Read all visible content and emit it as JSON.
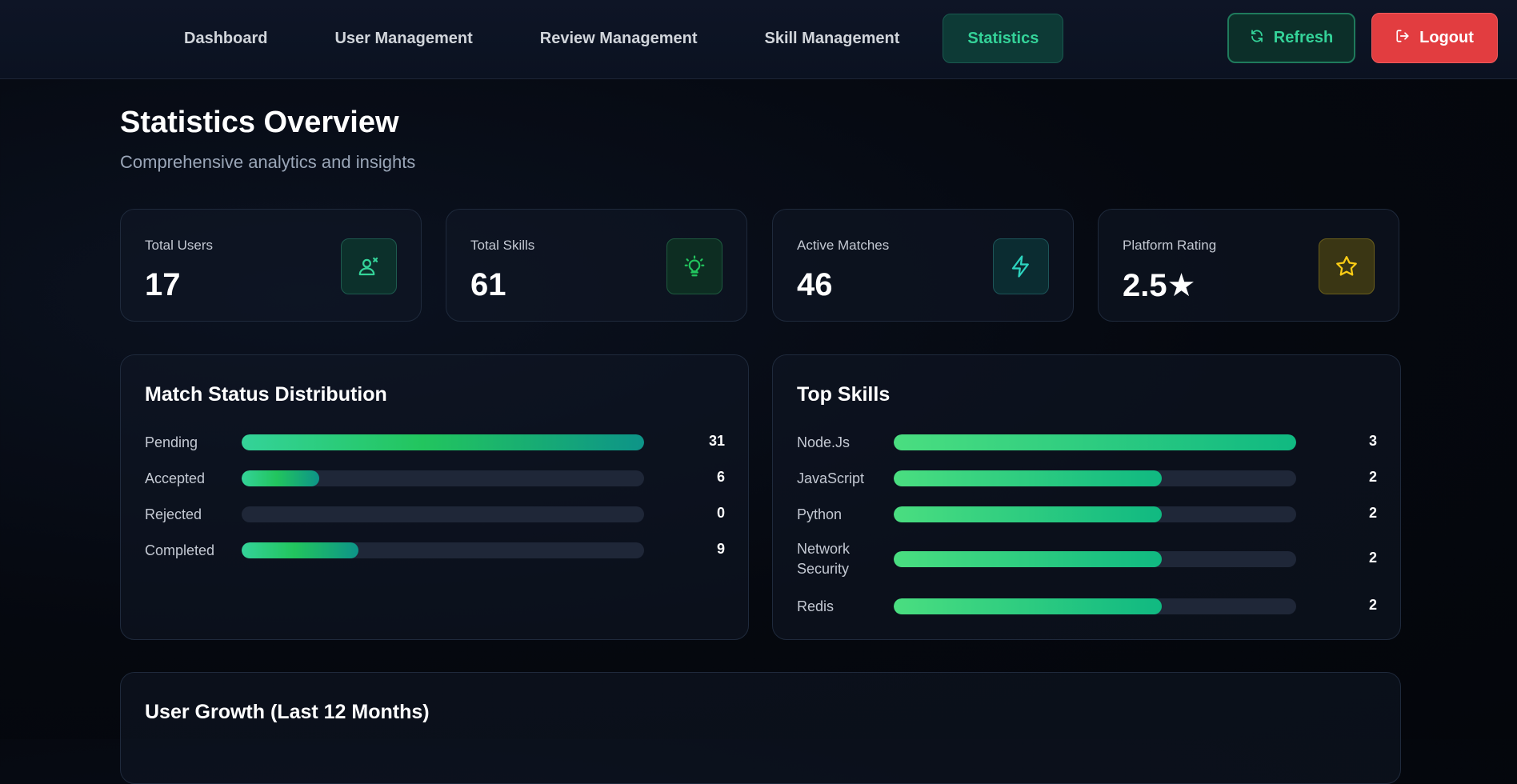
{
  "nav": {
    "items": [
      {
        "label": "Dashboard",
        "active": false
      },
      {
        "label": "User Management",
        "active": false
      },
      {
        "label": "Review Management",
        "active": false
      },
      {
        "label": "Skill Management",
        "active": false
      },
      {
        "label": "Statistics",
        "active": true
      }
    ],
    "refresh_label": "Refresh",
    "refresh_icon": "refresh-icon",
    "logout_label": "Logout",
    "logout_icon": "logout-icon"
  },
  "page": {
    "title": "Statistics Overview",
    "subtitle": "Comprehensive analytics and insights"
  },
  "stats": [
    {
      "label": "Total Users",
      "value": "17",
      "icon": "users-icon",
      "color": "#34d399"
    },
    {
      "label": "Total Skills",
      "value": "61",
      "icon": "lightbulb-icon",
      "color": "#22c55e"
    },
    {
      "label": "Active Matches",
      "value": "46",
      "icon": "lightning-icon",
      "color": "#2dd4bf"
    },
    {
      "label": "Platform Rating",
      "value": "2.5★",
      "icon": "star-icon",
      "color": "#facc15"
    }
  ],
  "match_status": {
    "title": "Match Status Distribution",
    "max": 31,
    "rows": [
      {
        "label": "Pending",
        "count": 31
      },
      {
        "label": "Accepted",
        "count": 6
      },
      {
        "label": "Rejected",
        "count": 0
      },
      {
        "label": "Completed",
        "count": 9
      }
    ]
  },
  "top_skills": {
    "title": "Top Skills",
    "max": 3,
    "rows": [
      {
        "label": "Node.Js",
        "count": 3
      },
      {
        "label": "JavaScript",
        "count": 2
      },
      {
        "label": "Python",
        "count": 2
      },
      {
        "label": "Network Security",
        "count": 2
      },
      {
        "label": "Redis",
        "count": 2
      }
    ]
  },
  "growth": {
    "title": "User Growth (Last 12 Months)"
  },
  "colors": {
    "accent": "#34d399",
    "danger": "#e23d40",
    "background": "#05080f"
  }
}
